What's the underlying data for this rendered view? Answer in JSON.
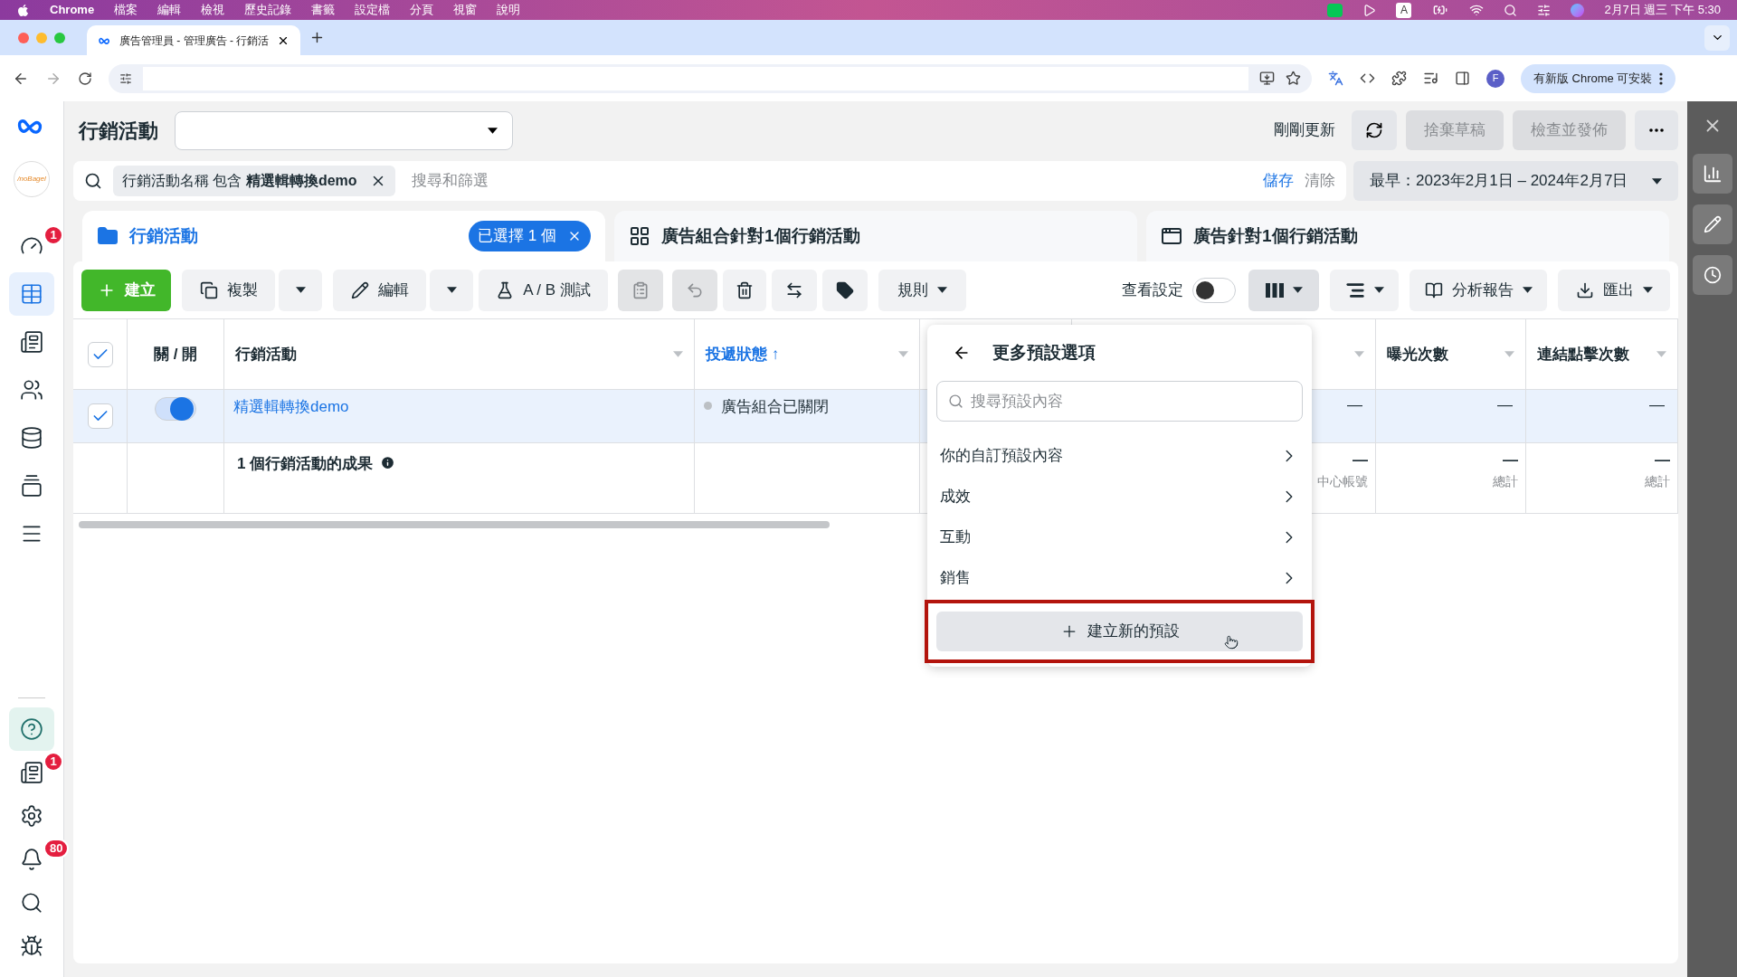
{
  "menu_bar": {
    "app": "Chrome",
    "items": [
      "檔案",
      "編輯",
      "檢視",
      "歷史記錄",
      "書籤",
      "設定檔",
      "分頁",
      "視窗",
      "說明"
    ],
    "input_source": "A",
    "clock": "2月7日 週三 下午 5:30"
  },
  "browser": {
    "tab_title": "廣告管理員 - 管理廣告 - 行銷活",
    "profile_initial": "F",
    "update_button": "有新版 Chrome 可安裝"
  },
  "sidebar": {
    "account_logo": "/noBagel",
    "items": [
      {
        "kind": "gauge",
        "badge": "1",
        "selected": false
      },
      {
        "kind": "table",
        "selected": true
      },
      {
        "kind": "pages",
        "selected": false
      },
      {
        "kind": "people",
        "selected": false
      },
      {
        "kind": "billing",
        "selected": false
      },
      {
        "kind": "media",
        "selected": false
      },
      {
        "kind": "menu",
        "selected": false
      }
    ],
    "bottom_items": [
      {
        "kind": "help"
      },
      {
        "kind": "news",
        "badge": "1"
      },
      {
        "kind": "settings"
      },
      {
        "kind": "bell",
        "badge": "80"
      },
      {
        "kind": "search"
      },
      {
        "kind": "bug"
      }
    ]
  },
  "header": {
    "title": "行銷活動",
    "status": "剛剛更新",
    "buttons": [
      {
        "label": "捨棄草稿",
        "disabled": true
      },
      {
        "label": "檢查並發佈",
        "disabled": true
      }
    ]
  },
  "filter": {
    "chip": "行銷活動名稱 包含 **精選輯轉換demo**",
    "placeholder": "搜尋和篩選",
    "save": "儲存",
    "clear": "清除",
    "date_range": "最早：2023年2月1日 – 2024年2月7日"
  },
  "tabs": [
    {
      "kind": "folder",
      "label": "行銷活動",
      "selected": true,
      "badge": "已選擇 1 個"
    },
    {
      "kind": "grid",
      "label": "廣告組合針對1個行銷活動",
      "selected": false
    },
    {
      "kind": "window",
      "label": "廣告針對1個行銷活動",
      "selected": false
    }
  ],
  "toolbar": {
    "create": "建立",
    "duplicate": "複製",
    "edit": "編輯",
    "ab_test": "A / B 測試",
    "rules": "規則",
    "view_settings": {
      "label": "查看設定",
      "on": false
    },
    "columns_open": true,
    "report": "分析報告",
    "export": "匯出"
  },
  "table": {
    "header_checked": true,
    "columns": [
      {
        "label": "關 / 開",
        "sorted": false
      },
      {
        "label": "行銷活動",
        "sorted": false
      },
      {
        "label": "投遞狀態 ↑",
        "sorted": true
      },
      {},
      {
        "sortable": true
      },
      {
        "label": "曝光次數",
        "sorted": false
      },
      {
        "label": "連結點擊次數",
        "sorted": false
      }
    ],
    "rows": [
      {
        "checked": true,
        "on": true,
        "name": "精選輯轉換demo",
        "status": "廣告組合已關閉",
        "cells": [
          "—",
          "—",
          "—"
        ]
      }
    ],
    "summary": {
      "label": "1 個行銷活動的成果",
      "cells": [
        {
          "value": "—",
          "note": "中心帳號"
        },
        {
          "value": "—",
          "note": "總計"
        },
        {
          "value": "—",
          "note": "總計"
        }
      ]
    }
  },
  "menu": {
    "title": "更多預設選項",
    "placeholder": "搜尋預設內容",
    "items": [
      "你的自訂預設內容",
      "成效",
      "互動",
      "銷售"
    ],
    "create": "建立新的預設",
    "highlighted": true
  }
}
